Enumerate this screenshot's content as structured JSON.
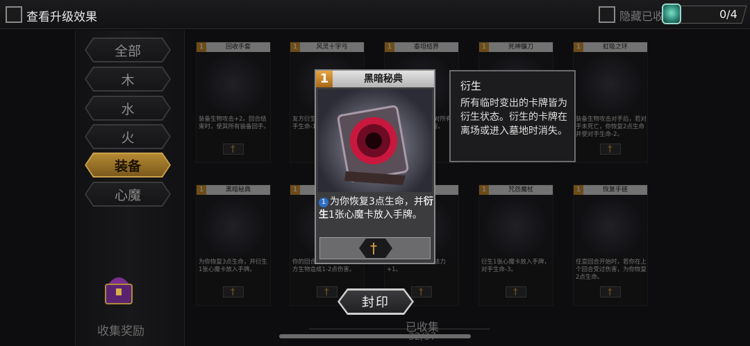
{
  "header": {
    "title": "查看升级效果",
    "hide_owned_label": "隐藏已收",
    "progress": "0/4"
  },
  "filters": [
    {
      "label": "全部",
      "active": false
    },
    {
      "label": "木",
      "active": false
    },
    {
      "label": "水",
      "active": false
    },
    {
      "label": "火",
      "active": false
    },
    {
      "label": "装备",
      "active": true
    },
    {
      "label": "心魔",
      "active": false
    }
  ],
  "reward": {
    "label": "收集奖励"
  },
  "cards": [
    {
      "cost": "1",
      "name": "回收手套",
      "desc": "装备生物攻击+2。回合结束时，使其所有装备回手。"
    },
    {
      "cost": "1",
      "name": "风灵十字弓",
      "desc": "友方衍生生物攻击时，使对手生命-1。"
    },
    {
      "cost": "1",
      "name": "泰坦结界",
      "desc": "你的回合开始时，对所有敌方生物造成1点伤害。"
    },
    {
      "cost": "1",
      "name": "死神镰刀",
      "desc": ""
    },
    {
      "cost": "1",
      "name": "虹吸之环",
      "desc": "装备生物攻击对手后，若对手未死亡，你恢复2点生命并使对手生命-2。"
    },
    {
      "cost": "1",
      "name": "黑暗秘典",
      "desc": "为你恢复3点生命，并衍生1张心魔卡放入手牌。"
    },
    {
      "cost": "1",
      "name": "",
      "desc": "你的回合开始时，对所有敌方生物造成1-2点伤害。"
    },
    {
      "cost": "1",
      "name": "",
      "desc": "你的回合开始时，法力+1。"
    },
    {
      "cost": "1",
      "name": "咒怨魔杖",
      "desc": "衍生1张心魔卡放入手牌，对手生命-3。"
    },
    {
      "cost": "1",
      "name": "恢复手链",
      "desc": "任意回合开始时，若你在上个回合受过伤害，为你恢复2点生命。"
    }
  ],
  "popup": {
    "cost": "1",
    "name": "黑暗秘典",
    "desc_part1": "为你恢复3点生命，并",
    "desc_keyword": "衍生",
    "desc_part2": "1张心魔卡放入手牌。",
    "badge": "1"
  },
  "tooltip": {
    "title": "衍生",
    "body": "所有临时变出的卡牌皆为衍生状态。衍生的卡牌在离场或进入墓地时消失。"
  },
  "seal_button": {
    "label": "封印"
  },
  "footer": {
    "collected_label": "已收集",
    "collected_count": "32/37"
  }
}
